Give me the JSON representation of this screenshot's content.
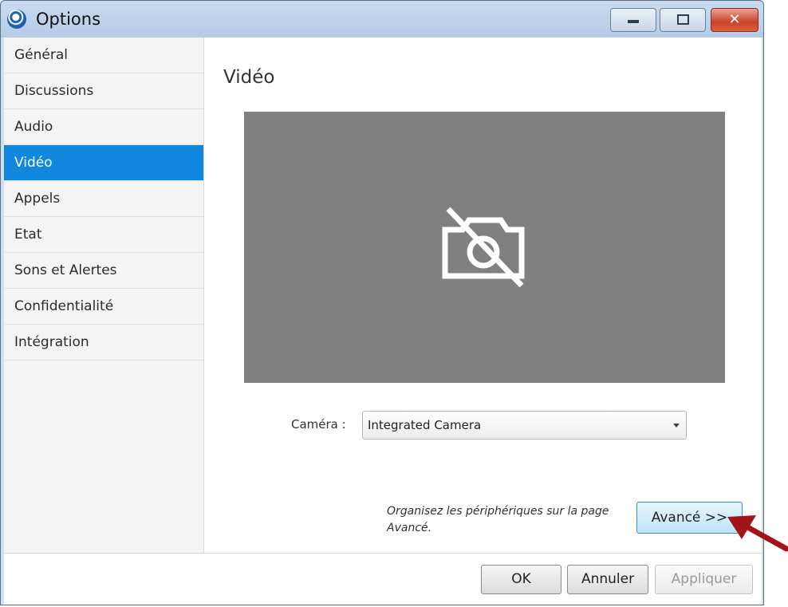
{
  "window": {
    "title": "Options",
    "controls": {
      "minimize": "",
      "maximize": "",
      "close": "✕"
    }
  },
  "sidebar": {
    "items": [
      {
        "label": "Général",
        "active": false
      },
      {
        "label": "Discussions",
        "active": false
      },
      {
        "label": "Audio",
        "active": false
      },
      {
        "label": "Vidéo",
        "active": true
      },
      {
        "label": "Appels",
        "active": false
      },
      {
        "label": "Etat",
        "active": false
      },
      {
        "label": "Sons et Alertes",
        "active": false
      },
      {
        "label": "Confidentialité",
        "active": false
      },
      {
        "label": "Intégration",
        "active": false
      }
    ]
  },
  "main": {
    "title": "Vidéo",
    "preview_icon": "camera-off-icon",
    "camera_label": "Caméra :",
    "camera_value": "Integrated Camera",
    "hint": "Organisez les périphériques sur la page Avancé.",
    "advanced_button": "Avancé >>"
  },
  "footer": {
    "ok": "OK",
    "cancel": "Annuler",
    "apply": "Appliquer",
    "apply_enabled": false
  },
  "colors": {
    "active_nav": "#1187de",
    "preview_bg": "#808080",
    "callout_arrow": "#a11417"
  }
}
